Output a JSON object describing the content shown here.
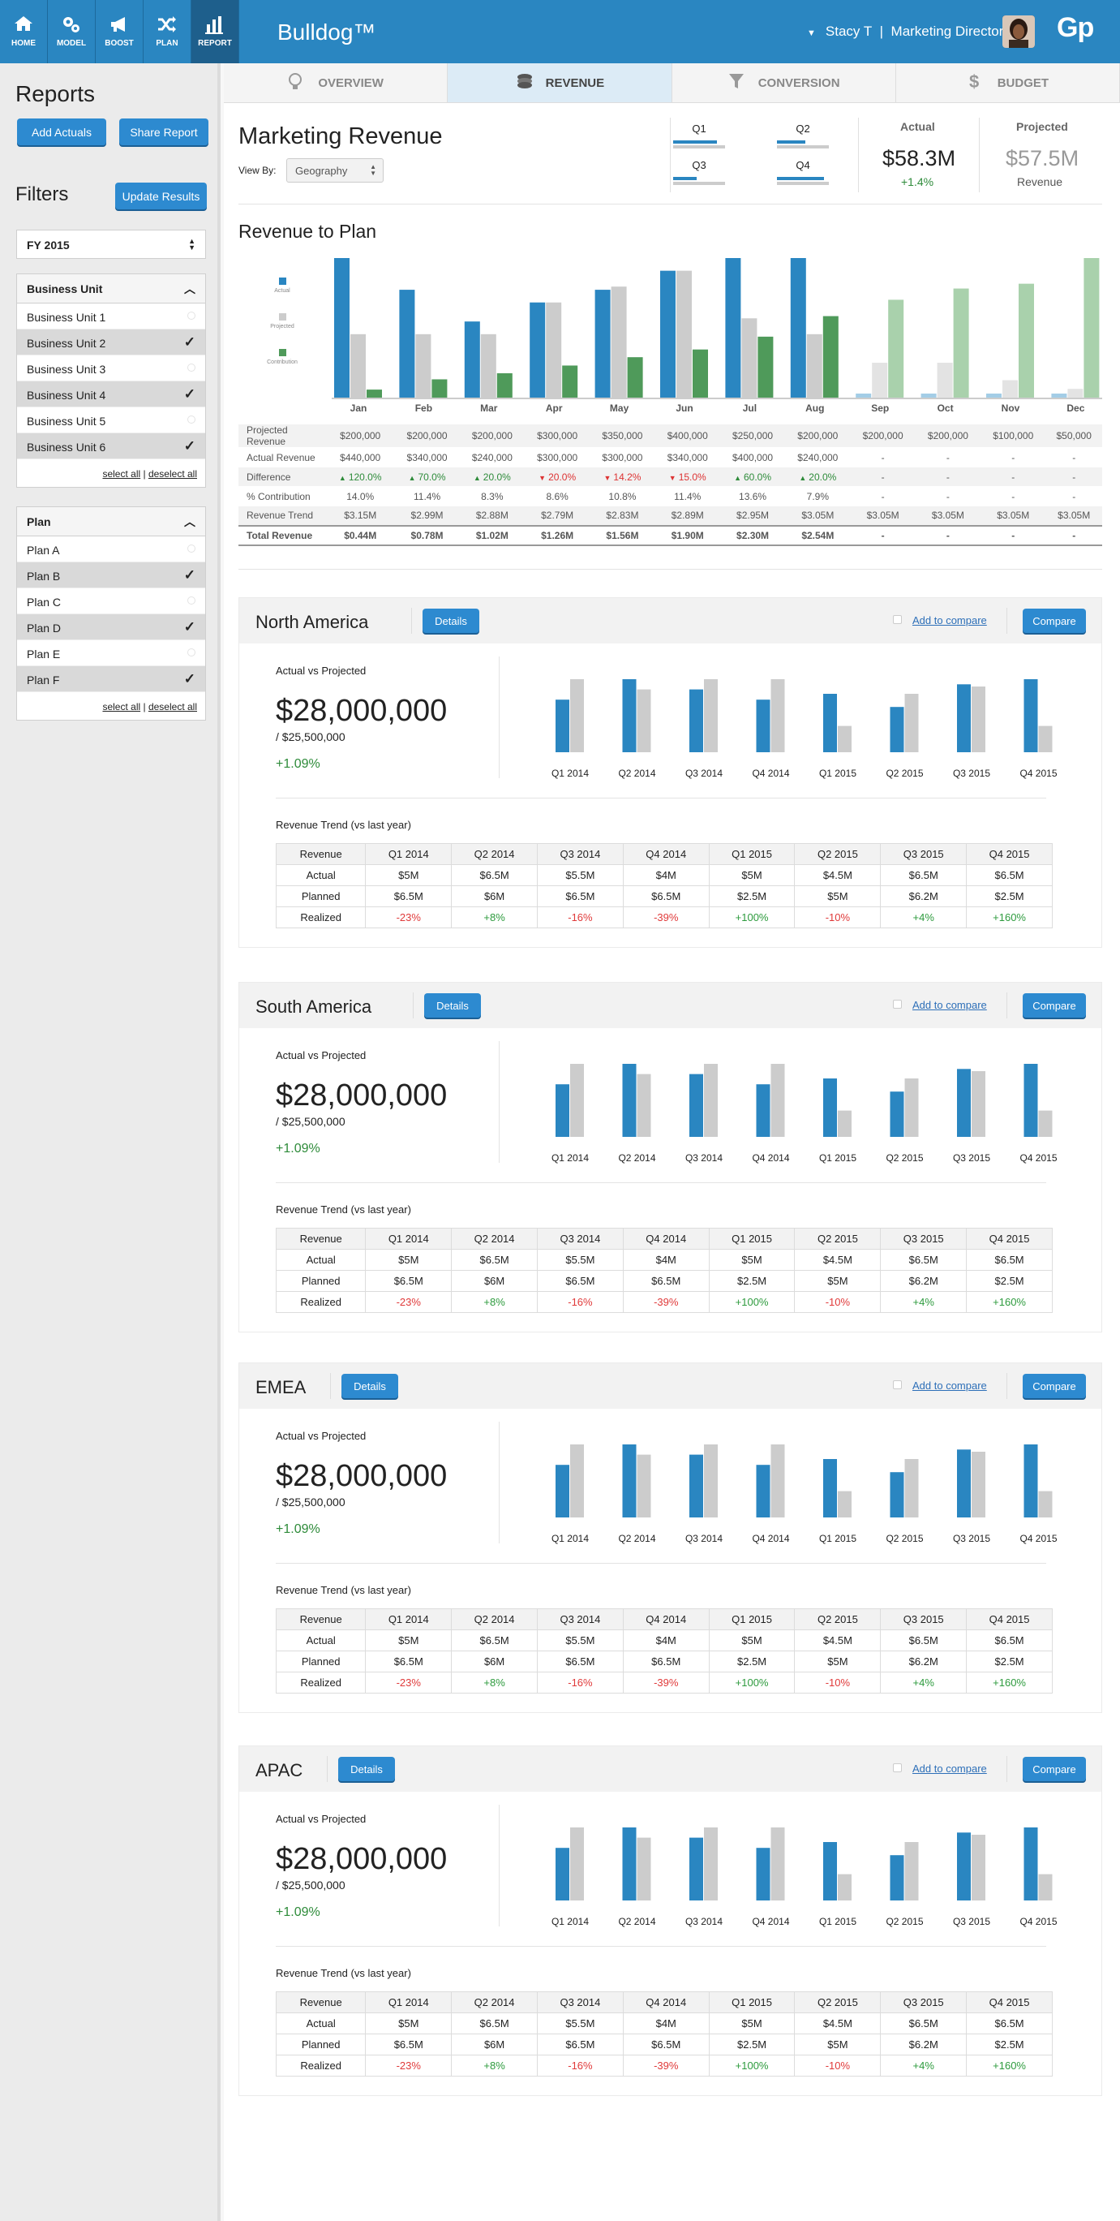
{
  "nav": [
    {
      "label": "HOME",
      "icon": "home-icon"
    },
    {
      "label": "MODEL",
      "icon": "gears-icon"
    },
    {
      "label": "BOOST",
      "icon": "megaphone-icon"
    },
    {
      "label": "PLAN",
      "icon": "shuffle-icon"
    },
    {
      "label": "REPORT",
      "icon": "bar-chart-icon",
      "active": true
    }
  ],
  "brand": "Bulldog™",
  "user": {
    "name": "Stacy T",
    "role": "Marketing Director"
  },
  "logo": "Gp",
  "sidebar": {
    "title": "Reports",
    "add_actuals": "Add Actuals",
    "share_report": "Share Report",
    "filters": "Filters",
    "update": "Update Results",
    "fiscal": "FY 2015",
    "bu": {
      "title": "Business Unit",
      "items": [
        {
          "label": "Business Unit 1",
          "checked": false
        },
        {
          "label": "Business Unit 2",
          "checked": true
        },
        {
          "label": "Business Unit 3",
          "checked": false
        },
        {
          "label": "Business Unit 4",
          "checked": true
        },
        {
          "label": "Business Unit 5",
          "checked": false
        },
        {
          "label": "Business Unit 6",
          "checked": true
        }
      ]
    },
    "plan": {
      "title": "Plan",
      "items": [
        {
          "label": "Plan A",
          "checked": false
        },
        {
          "label": "Plan B",
          "checked": true
        },
        {
          "label": "Plan C",
          "checked": false
        },
        {
          "label": "Plan D",
          "checked": true
        },
        {
          "label": "Plan E",
          "checked": false
        },
        {
          "label": "Plan F",
          "checked": true
        }
      ]
    },
    "select_all": "select all",
    "deselect_all": "deselect all"
  },
  "tabs": [
    {
      "label": "OVERVIEW",
      "icon": "lightbulb-icon"
    },
    {
      "label": "REVENUE",
      "icon": "coins-icon",
      "active": true
    },
    {
      "label": "CONVERSION",
      "icon": "funnel-icon"
    },
    {
      "label": "BUDGET",
      "icon": "dollar-icon"
    }
  ],
  "header": {
    "title": "Marketing Revenue",
    "view_by": "View By:",
    "geography": "Geography",
    "quarters": [
      {
        "label": "Q1",
        "progress": 0.85
      },
      {
        "label": "Q2",
        "progress": 0.55
      },
      {
        "label": "Q3",
        "progress": 0.45
      },
      {
        "label": "Q4",
        "progress": 0.9
      }
    ],
    "actual_label": "Actual",
    "actual_value": "$58.3M",
    "actual_change": "+1.4%",
    "projected_label": "Projected",
    "projected_value": "$57.5M",
    "projected_sub": "Revenue"
  },
  "colors": {
    "actual": "#2a86c1",
    "projected": "#cccccc",
    "contribution": "#4f9a5a",
    "actual_light": "#a3cde6",
    "projected_light": "#e3e3e3",
    "contribution_light": "#a9d1ac"
  },
  "chart_data": {
    "type": "bar",
    "title": "Revenue to Plan",
    "categories": [
      "Jan",
      "Feb",
      "Mar",
      "Apr",
      "May",
      "Jun",
      "Jul",
      "Aug",
      "Sep",
      "Oct",
      "Nov",
      "Dec"
    ],
    "series": [
      {
        "name": "Actual",
        "values": [
          440000,
          340000,
          240000,
          300000,
          340000,
          400000,
          440000,
          440000,
          null,
          null,
          null,
          null
        ]
      },
      {
        "name": "Projected",
        "values": [
          200000,
          200000,
          200000,
          300000,
          350000,
          400000,
          250000,
          200000,
          200000,
          200000,
          100000,
          50000
        ]
      },
      {
        "name": "Contribution",
        "values": [
          0.25,
          0.57,
          0.76,
          1.0,
          1.26,
          1.5,
          1.9,
          2.54,
          null,
          null,
          null,
          null
        ]
      }
    ],
    "forecast_values": {
      "Projected": [
        null,
        null,
        null,
        null,
        null,
        null,
        null,
        null,
        3.05,
        3.4,
        3.55,
        4.35
      ]
    },
    "legend": [
      "Actual",
      "Projected",
      "Contribution"
    ],
    "legend_position": "left"
  },
  "table": {
    "rows": [
      {
        "label": "Projected Revenue",
        "cells": [
          "$200,000",
          "$200,000",
          "$200,000",
          "$300,000",
          "$350,000",
          "$400,000",
          "$250,000",
          "$200,000",
          "$200,000",
          "$200,000",
          "$100,000",
          "$50,000"
        ]
      },
      {
        "label": "Actual Revenue",
        "cells": [
          "$440,000",
          "$340,000",
          "$240,000",
          "$300,000",
          "$300,000",
          "$340,000",
          "$400,000",
          "$240,000",
          "-",
          "-",
          "-",
          "-"
        ]
      },
      {
        "label": "Difference",
        "cells": [
          "120.0%",
          "70.0%",
          "20.0%",
          "20.0%",
          "14.2%",
          "15.0%",
          "60.0%",
          "20.0%",
          "-",
          "-",
          "-",
          "-"
        ],
        "dirs": [
          "up",
          "up",
          "up",
          "down",
          "down",
          "down",
          "up",
          "up",
          "",
          "",
          "",
          ""
        ]
      },
      {
        "label": "% Contribution",
        "cells": [
          "14.0%",
          "11.4%",
          "8.3%",
          "8.6%",
          "10.8%",
          "11.4%",
          "13.6%",
          "7.9%",
          "-",
          "-",
          "-",
          "-"
        ]
      },
      {
        "label": "Revenue Trend",
        "cells": [
          "$3.15M",
          "$2.99M",
          "$2.88M",
          "$2.79M",
          "$2.83M",
          "$2.89M",
          "$2.95M",
          "$3.05M",
          "$3.05M",
          "$3.05M",
          "$3.05M",
          "$3.05M"
        ]
      },
      {
        "label": "Total Revenue",
        "cells": [
          "$0.44M",
          "$0.78M",
          "$1.02M",
          "$1.26M",
          "$1.56M",
          "$1.90M",
          "$2.30M",
          "$2.54M",
          "-",
          "-",
          "-",
          "-"
        ]
      }
    ]
  },
  "regions": [
    {
      "name": "North America",
      "details": "Details",
      "add_compare": "Add to compare",
      "compare": "Compare",
      "avp": "Actual vs Projected",
      "big": "$28,000,000",
      "sub": "/ $25,500,000",
      "pct": "+1.09%",
      "trend_title": "Revenue Trend (vs last year)"
    },
    {
      "name": "South America",
      "details": "Details",
      "add_compare": "Add to compare",
      "compare": "Compare",
      "avp": "Actual vs Projected",
      "big": "$28,000,000",
      "sub": "/ $25,500,000",
      "pct": "+1.09%",
      "trend_title": "Revenue Trend (vs last year)"
    },
    {
      "name": "EMEA",
      "details": "Details",
      "add_compare": "Add to compare",
      "compare": "Compare",
      "avp": "Actual vs Projected",
      "big": "$28,000,000",
      "sub": "/ $25,500,000",
      "pct": "+1.09%",
      "trend_title": "Revenue Trend (vs last year)"
    },
    {
      "name": "APAC",
      "details": "Details",
      "add_compare": "Add to compare",
      "compare": "Compare",
      "avp": "Actual vs Projected",
      "big": "$28,000,000",
      "sub": "/ $25,500,000",
      "pct": "+1.09%",
      "trend_title": "Revenue Trend (vs last year)"
    }
  ],
  "region_chart": {
    "categories": [
      "Q1 2014",
      "Q2 2014",
      "Q3 2014",
      "Q4 2014",
      "Q1 2015",
      "Q2 2015",
      "Q3 2015",
      "Q4 2015"
    ],
    "actual": [
      0.72,
      1.0,
      0.86,
      0.72,
      0.8,
      0.62,
      0.93,
      1.0
    ],
    "projected": [
      1.0,
      0.86,
      1.0,
      1.0,
      0.36,
      0.8,
      0.9,
      0.36
    ]
  },
  "region_table": {
    "header": [
      "Revenue",
      "Q1 2014",
      "Q2 2014",
      "Q3 2014",
      "Q4 2014",
      "Q1 2015",
      "Q2 2015",
      "Q3 2015",
      "Q4 2015"
    ],
    "rows": [
      [
        "Actual",
        "$5M",
        "$6.5M",
        "$5.5M",
        "$4M",
        "$5M",
        "$4.5M",
        "$6.5M",
        "$6.5M"
      ],
      [
        "Planned",
        "$6.5M",
        "$6M",
        "$6.5M",
        "$6.5M",
        "$2.5M",
        "$5M",
        "$6.2M",
        "$2.5M"
      ],
      [
        "Realized",
        "-23%",
        "+8%",
        "-16%",
        "-39%",
        "+100%",
        "-10%",
        "+4%",
        "+160%"
      ]
    ]
  }
}
